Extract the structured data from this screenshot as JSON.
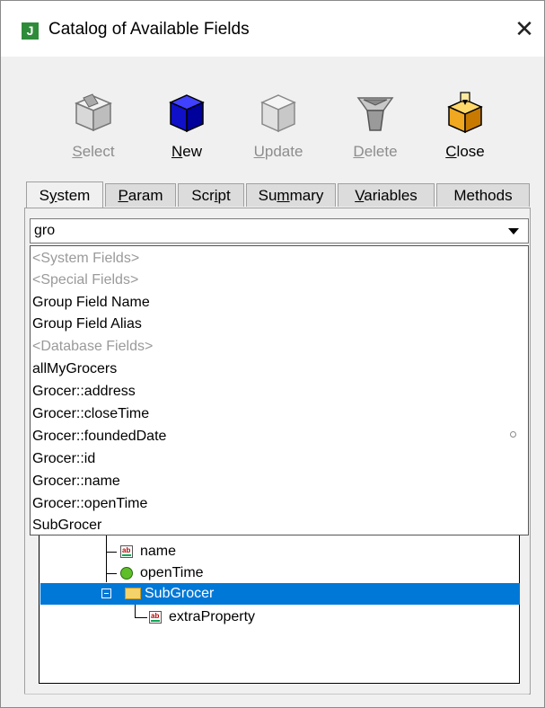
{
  "window": {
    "title": "Catalog of Available Fields",
    "app_icon_letter": "J",
    "close_glyph": "✕"
  },
  "toolbar": {
    "select": {
      "prefix": "",
      "underline": "S",
      "rest": "elect",
      "enabled": false,
      "icon": "select-cube-icon"
    },
    "new": {
      "prefix": "",
      "underline": "N",
      "rest": "ew",
      "enabled": true,
      "icon": "new-cube-icon"
    },
    "update": {
      "prefix": "",
      "underline": "U",
      "rest": "pdate",
      "enabled": false,
      "icon": "update-cube-icon"
    },
    "delete": {
      "prefix": "",
      "underline": "D",
      "rest": "elete",
      "enabled": false,
      "icon": "delete-bin-icon"
    },
    "close": {
      "prefix": "",
      "underline": "C",
      "rest": "lose",
      "enabled": true,
      "icon": "close-box-icon"
    }
  },
  "tabs": [
    {
      "pre": "S",
      "ul": "y",
      "post": "stem",
      "active": true
    },
    {
      "pre": "",
      "ul": "P",
      "post": "aram",
      "active": false
    },
    {
      "pre": "Scr",
      "ul": "i",
      "post": "pt",
      "active": false
    },
    {
      "pre": "Su",
      "ul": "m",
      "post": "mary",
      "active": false
    },
    {
      "pre": "",
      "ul": "V",
      "post": "ariables",
      "active": false
    },
    {
      "pre": "Methods",
      "ul": "",
      "post": "",
      "active": false
    }
  ],
  "combo": {
    "value": "gro"
  },
  "dropdown": {
    "items": [
      {
        "text": "<System Fields>",
        "kind": "header"
      },
      {
        "text": "<Special Fields>",
        "kind": "header"
      },
      {
        "text": "Group Field Name",
        "kind": "field"
      },
      {
        "text": "Group Field Alias",
        "kind": "field"
      },
      {
        "text": "<Database Fields>",
        "kind": "header"
      },
      {
        "text": "allMyGrocers",
        "kind": "field"
      },
      {
        "text": "Grocer::address",
        "kind": "field"
      },
      {
        "text": "Grocer::closeTime",
        "kind": "field"
      },
      {
        "text": "Grocer::foundedDate",
        "kind": "field"
      },
      {
        "text": "Grocer::id",
        "kind": "field"
      },
      {
        "text": "Grocer::name",
        "kind": "field"
      },
      {
        "text": "Grocer::openTime",
        "kind": "field"
      },
      {
        "text": "SubGrocer",
        "kind": "field"
      }
    ]
  },
  "tree": {
    "name": "name",
    "open_time": "openTime",
    "sub_grocer": "SubGrocer",
    "extra_property": "extraProperty"
  },
  "colors": {
    "selection": "#0078d7",
    "app_icon": "#2e8b3a",
    "disabled_text": "#8d8d8d"
  }
}
